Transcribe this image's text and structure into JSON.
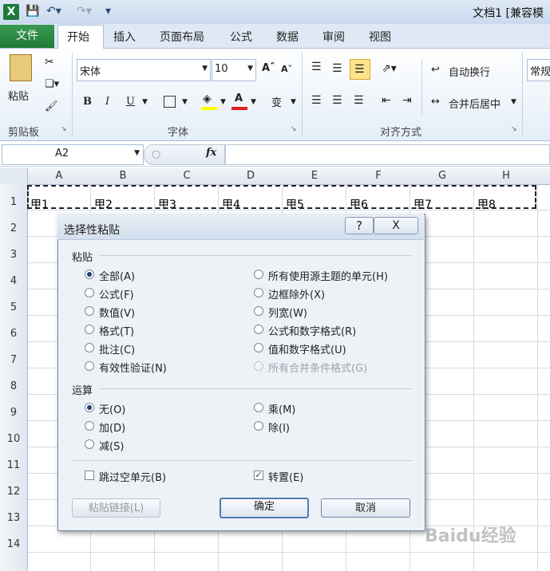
{
  "window": {
    "title": "文档1  [兼容模"
  },
  "ribbon_tabs": [
    "文件",
    "开始",
    "插入",
    "页面布局",
    "公式",
    "数据",
    "审阅",
    "视图"
  ],
  "ribbon": {
    "clipboard": {
      "paste_label": "粘贴",
      "group_label": "剪贴板"
    },
    "font": {
      "name": "宋体",
      "size": "10",
      "group_label": "字体",
      "grow": "A",
      "shrink": "A",
      "bold": "B",
      "italic": "I",
      "underline": "U",
      "font_color_letter": "A",
      "phonetic": "变"
    },
    "alignment": {
      "wrap_text": "自动换行",
      "merge_center": "合并后居中",
      "group_label": "对齐方式"
    },
    "number": {
      "format": "常规"
    }
  },
  "formula_bar": {
    "name_box": "A2",
    "fx": "fx",
    "value": ""
  },
  "sheet": {
    "columns": [
      "A",
      "B",
      "C",
      "D",
      "E",
      "F",
      "G",
      "H"
    ],
    "rows": [
      "1",
      "2",
      "3",
      "4",
      "5",
      "6",
      "7",
      "8",
      "9",
      "10",
      "11",
      "12",
      "13",
      "14"
    ],
    "row1_cells": [
      "甲1",
      "甲2",
      "甲3",
      "甲4",
      "甲5",
      "甲6",
      "甲7",
      "甲8"
    ]
  },
  "dialog": {
    "title": "选择性粘贴",
    "help": "?",
    "close": "X",
    "paste_section": "粘贴",
    "paste_left": [
      {
        "label": "全部(A)",
        "selected": true
      },
      {
        "label": "公式(F)",
        "selected": false
      },
      {
        "label": "数值(V)",
        "selected": false
      },
      {
        "label": "格式(T)",
        "selected": false
      },
      {
        "label": "批注(C)",
        "selected": false
      },
      {
        "label": "有效性验证(N)",
        "selected": false
      }
    ],
    "paste_right": [
      {
        "label": "所有使用源主题的单元(H)",
        "selected": false
      },
      {
        "label": "边框除外(X)",
        "selected": false
      },
      {
        "label": "列宽(W)",
        "selected": false
      },
      {
        "label": "公式和数字格式(R)",
        "selected": false
      },
      {
        "label": "值和数字格式(U)",
        "selected": false
      },
      {
        "label": "所有合并条件格式(G)",
        "selected": false,
        "disabled": true
      }
    ],
    "operation_section": "运算",
    "op_left": [
      {
        "label": "无(O)",
        "selected": true
      },
      {
        "label": "加(D)",
        "selected": false
      },
      {
        "label": "减(S)",
        "selected": false
      }
    ],
    "op_right": [
      {
        "label": "乘(M)",
        "selected": false
      },
      {
        "label": "除(I)",
        "selected": false
      }
    ],
    "skip_blanks": {
      "label": "跳过空单元(B)",
      "checked": false
    },
    "transpose": {
      "label": "转置(E)",
      "checked": true
    },
    "paste_link_button": "粘贴链接(L)",
    "ok_button": "确定",
    "cancel_button": "取消"
  },
  "watermark": "Baidu经验"
}
